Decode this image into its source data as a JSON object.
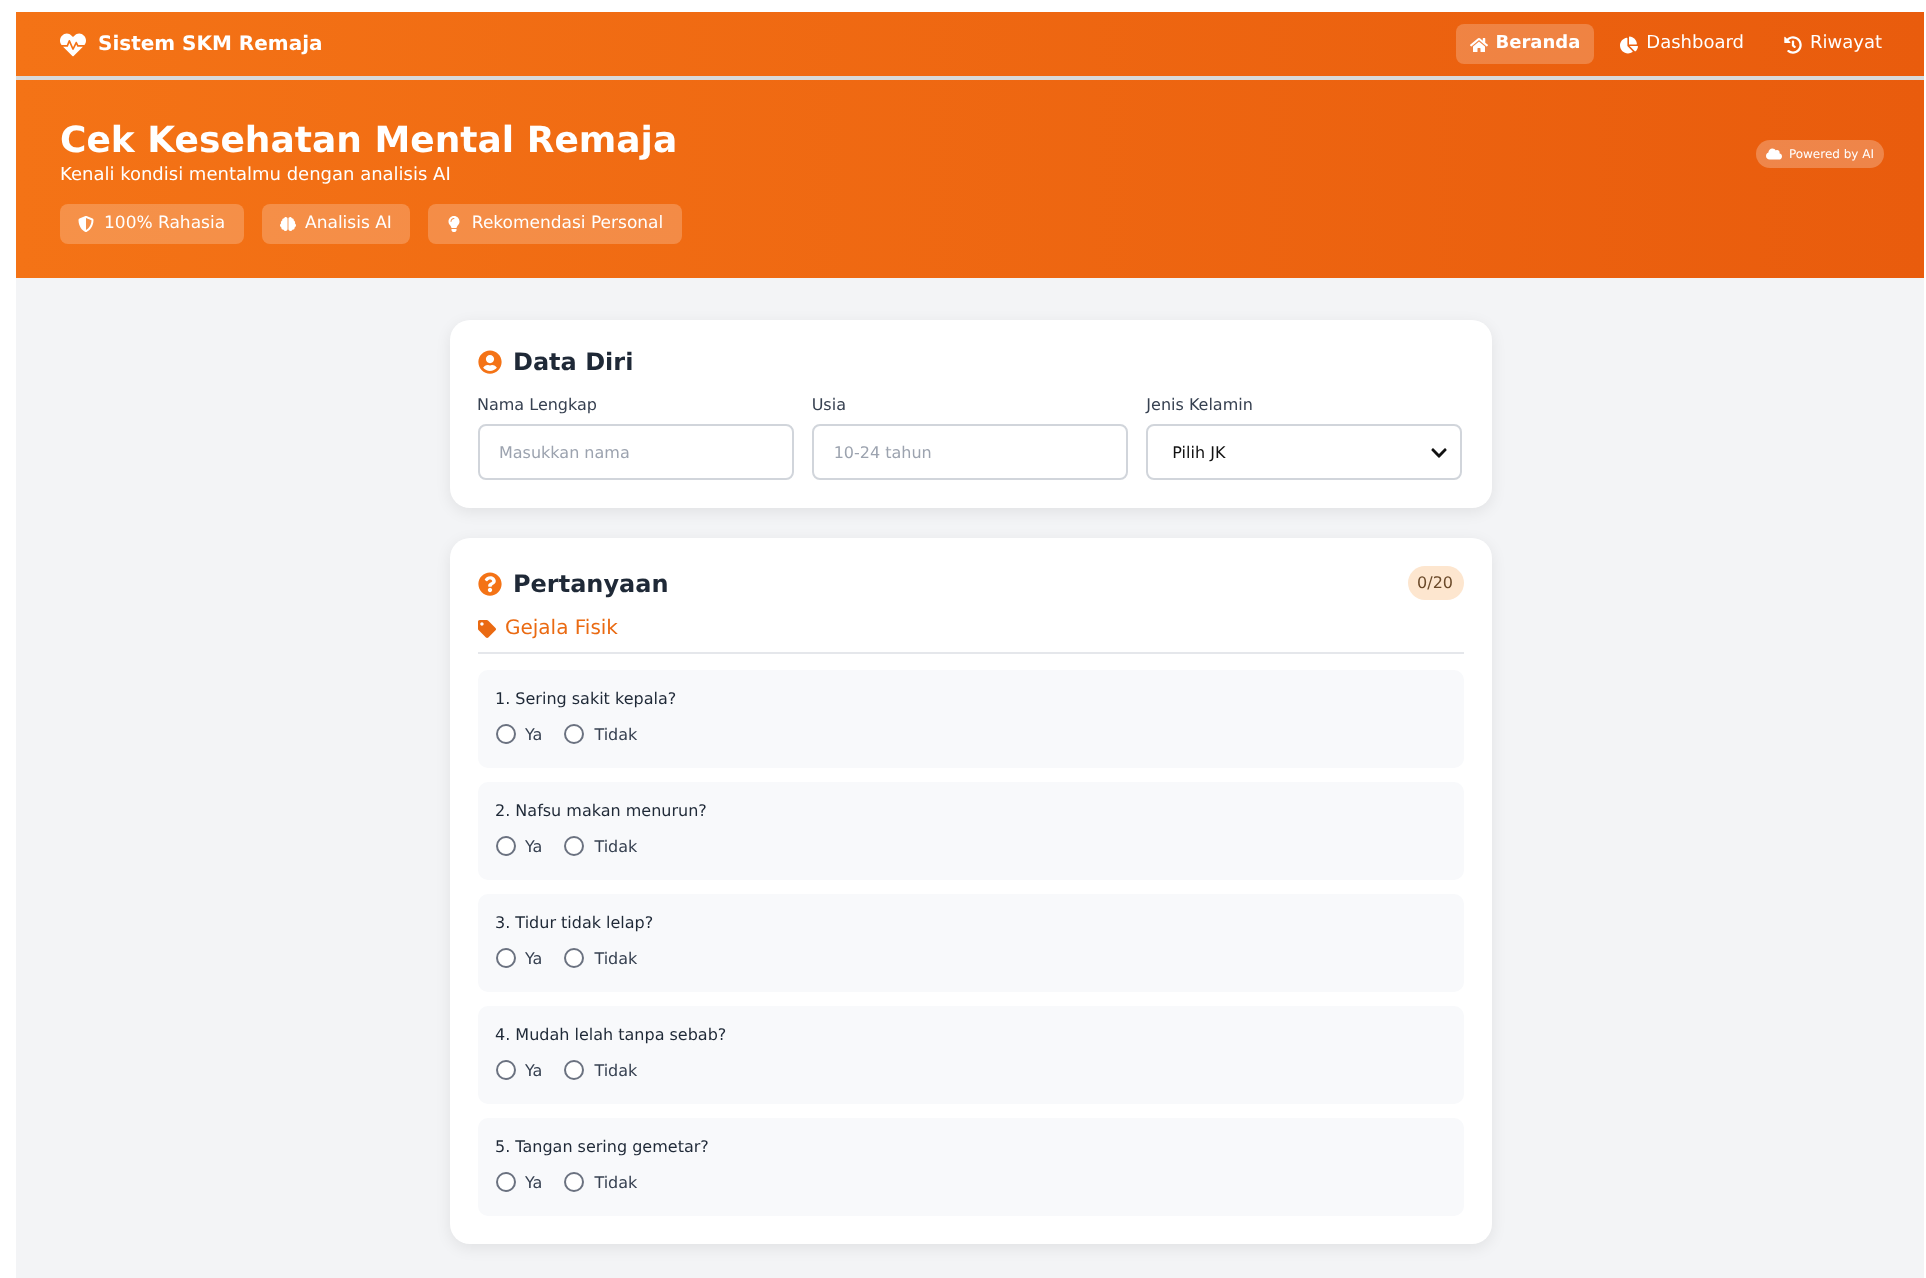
{
  "navbar": {
    "brand": "Sistem SKM Remaja",
    "links": [
      {
        "label": "Beranda",
        "selected": true
      },
      {
        "label": "Dashboard",
        "selected": false
      },
      {
        "label": "Riwayat",
        "selected": false
      }
    ]
  },
  "hero": {
    "title": "Cek Kesehatan Mental Remaja",
    "subtitle": "Kenali kondisi mentalmu dengan analisis AI",
    "badge": "Powered by AI",
    "features": [
      {
        "label": "100% Rahasia"
      },
      {
        "label": "Analisis AI"
      },
      {
        "label": "Rekomendasi Personal"
      }
    ]
  },
  "personal": {
    "title": "Data Diri",
    "fields": [
      {
        "kind": "input",
        "label": "Nama Lengkap",
        "placeholder": "Masukkan nama"
      },
      {
        "kind": "input",
        "label": "Usia",
        "placeholder": "10-24 tahun"
      },
      {
        "kind": "select",
        "label": "Jenis Kelamin",
        "value": "Pilih JK"
      }
    ]
  },
  "questions": {
    "title": "Pertanyaan",
    "progress": "0/20",
    "category": "Gejala Fisik",
    "items": [
      {
        "text": "1. Sering sakit kepala?",
        "options": [
          {
            "label": "Ya",
            "selected": false
          },
          {
            "label": "Tidak",
            "selected": false
          }
        ]
      },
      {
        "text": "2. Nafsu makan menurun?",
        "options": [
          {
            "label": "Ya",
            "selected": false
          },
          {
            "label": "Tidak",
            "selected": false
          }
        ]
      },
      {
        "text": "3. Tidur tidak lelap?",
        "options": [
          {
            "label": "Ya",
            "selected": false
          },
          {
            "label": "Tidak",
            "selected": false
          }
        ]
      },
      {
        "text": "4. Mudah lelah tanpa sebab?",
        "options": [
          {
            "label": "Ya",
            "selected": false
          },
          {
            "label": "Tidak",
            "selected": false
          }
        ]
      },
      {
        "text": "5. Tangan sering gemetar?",
        "options": [
          {
            "label": "Ya",
            "selected": false
          },
          {
            "label": "Tidak",
            "selected": false
          }
        ]
      }
    ]
  }
}
